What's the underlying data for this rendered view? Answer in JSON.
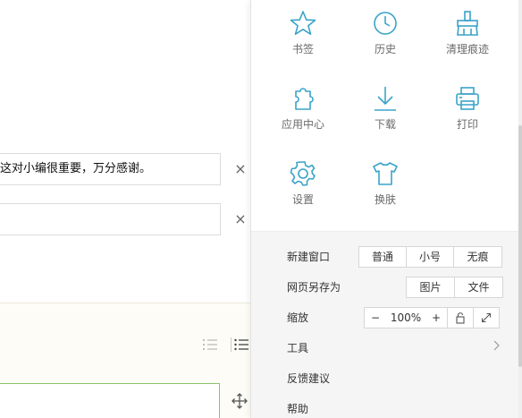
{
  "background_page": {
    "feedback_text": "这对小编很重要，万分感谢。",
    "second_input_value": "",
    "remove_glyph": "×"
  },
  "menu": {
    "grid_items": [
      {
        "label": "书签",
        "icon": "star-icon"
      },
      {
        "label": "历史",
        "icon": "clock-icon"
      },
      {
        "label": "清理痕迹",
        "icon": "broom-icon"
      },
      {
        "label": "应用中心",
        "icon": "puzzle-icon"
      },
      {
        "label": "下载",
        "icon": "download-icon"
      },
      {
        "label": "打印",
        "icon": "printer-icon"
      },
      {
        "label": "设置",
        "icon": "gear-icon"
      },
      {
        "label": "换肤",
        "icon": "shirt-icon"
      }
    ],
    "new_window": {
      "label": "新建窗口",
      "options": [
        "普通",
        "小号",
        "无痕"
      ]
    },
    "save_page": {
      "label": "网页另存为",
      "options": [
        "图片",
        "文件"
      ]
    },
    "zoom": {
      "label": "缩放",
      "minus": "−",
      "value": "100%",
      "plus": "+"
    },
    "tools": {
      "label": "工具"
    },
    "feedback": {
      "label": "反馈建议"
    },
    "help": {
      "label": "帮助"
    }
  },
  "colors": {
    "icon_accent": "#3aa3c8",
    "menu_bg": "#f5f5f5"
  }
}
